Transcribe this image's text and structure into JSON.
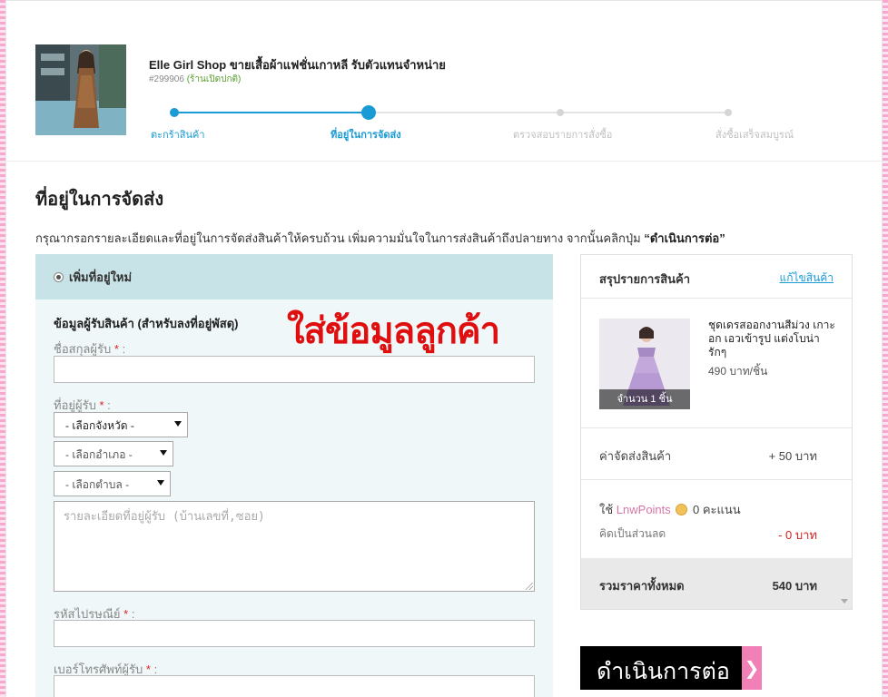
{
  "shop": {
    "name": "Elle Girl Shop ขายเสื้อผ้าแฟชั่นเกาหลี รับตัวแทนจำหน่าย",
    "id": "#299906",
    "status": "(ร้านเปิดปกติ)"
  },
  "steps": [
    {
      "label": "ตะกร้าสินค้า",
      "state": "done"
    },
    {
      "label": "ที่อยู่ในการจัดส่ง",
      "state": "current"
    },
    {
      "label": "ตรวจสอบรายการสั่งซื้อ",
      "state": "pending"
    },
    {
      "label": "สั่งซื้อเสร็จสมบูรณ์",
      "state": "pending"
    }
  ],
  "page": {
    "title": "ที่อยู่ในการจัดส่ง",
    "instruction": "กรุณากรอกรายละเอียดและที่อยู่ในการจัดส่งสินค้าให้ครบถ้วน เพิ่มความมั่นใจในการส่งสินค้าถึงปลายทาง จากนั้นคลิกปุ่ม ",
    "instruction_button": "“ดำเนินการต่อ”"
  },
  "form": {
    "new_address_label": "เพิ่มที่อยู่ใหม่",
    "section_title": "ข้อมูลผู้รับสินค้า (สำหรับลงที่อยู่พัสดุ)",
    "name_label": "ชื่อสกุลผู้รับ",
    "address_label": "ที่อยู่ผู้รับ",
    "province_select": "- เลือกจังหวัด -",
    "district_select": "- เลือกอำเภอ -",
    "subdistrict_select": "- เลือกตำบล -",
    "address_detail_placeholder": "รายละเอียดที่อยู่ผู้รับ (บ้านเลขที่,ซอย)",
    "postcode_label": "รหัสไปรษณีย์",
    "phone_label": "เบอร์โทรศัพท์ผู้รับ",
    "required_mark": "*",
    "colon": " :"
  },
  "overlay_text": "ใส่ข้อมูลลูกค้า",
  "summary": {
    "title": "สรุปรายการสินค้า",
    "edit_link": "แก้ไขสินค้า",
    "product": {
      "name": "ชุดเดรสออกงานสีม่วง เกาะอก เอวเข้ารูป แต่งโบน่ารักๆ",
      "price": "490 บาท/ชิ้น",
      "quantity": "จำนวน 1 ชิ้น"
    },
    "shipping_label": "ค่าจัดส่งสินค้า",
    "shipping_value": "+ 50 บาท",
    "points_prefix": "ใช้ ",
    "points_name": "LnwPoints",
    "points_value": " 0 คะแนน",
    "discount_label": "คิดเป็นส่วนลด",
    "discount_value": "- 0 บาท",
    "total_label": "รวมราคาทั้งหมด",
    "total_value": "540 บาท"
  },
  "proceed_button": "ดำเนินการต่อ",
  "colors": {
    "accent": "#1a9bd6",
    "overlay": "#e00f0f",
    "form_header_bg": "#c8e3e7",
    "form_bg": "#eff7f8",
    "pink": "#f080b6"
  }
}
